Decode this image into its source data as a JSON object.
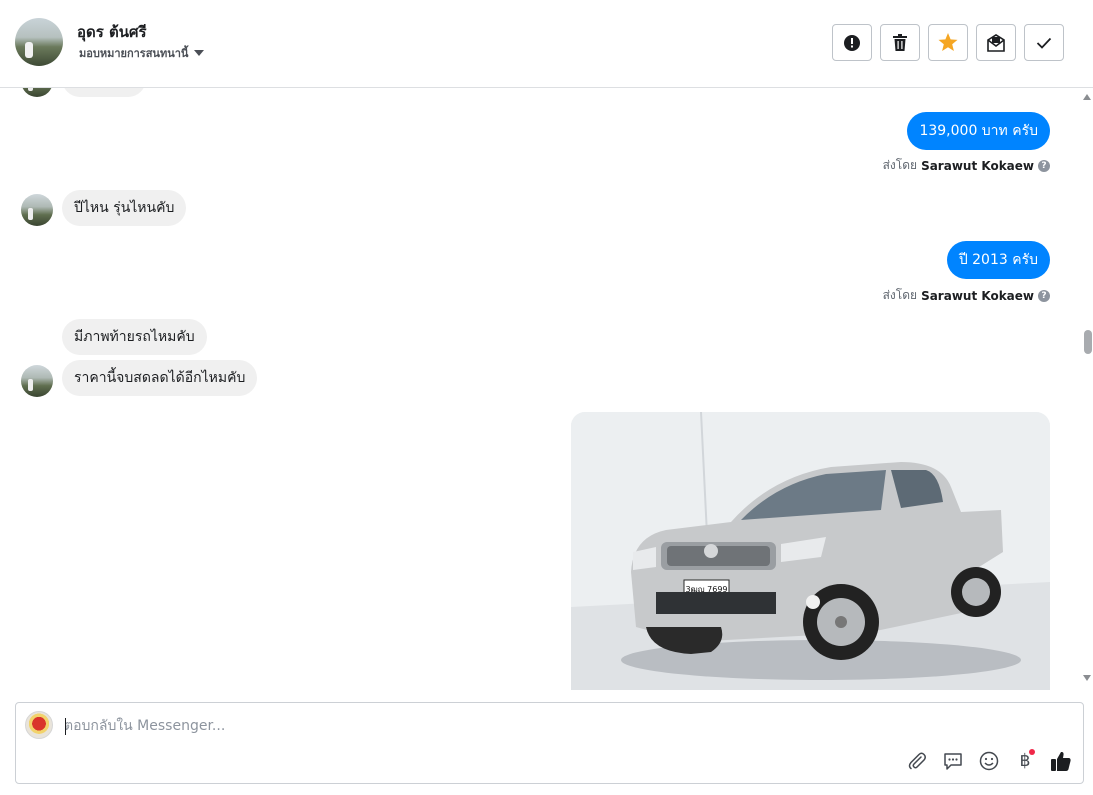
{
  "header": {
    "contact_name": "อุดร ต้นศรี",
    "assign_label": "มอบหมายการสนทนานี้"
  },
  "toolbar": {
    "icons": [
      "alert-icon",
      "trash-icon",
      "star-icon",
      "mark-unread-icon",
      "check-icon"
    ],
    "star_color": "#f5a623"
  },
  "messages": [
    {
      "from": "them",
      "text": "ปีไหน รุ่นไหนคับ"
    },
    {
      "from": "me",
      "text": "139,000 บาท ครับ"
    },
    {
      "from": "me",
      "text": "ปี 2013 ครับ"
    },
    {
      "from": "them",
      "text": "มีภาพท้ายรถไหมคับ"
    },
    {
      "from": "them",
      "text": "ราคานี้จบสดลดได้อีกไหมคับ"
    }
  ],
  "sent_by": {
    "prefix": "ส่งโดย",
    "name": "Sarawut Kokaew"
  },
  "photo": {
    "plate_text": "3ฒญ 7699"
  },
  "composer": {
    "placeholder": "ตอบกลับใน Messenger..."
  },
  "composer_tools": [
    "paperclip-icon",
    "saved-replies-icon",
    "emoji-icon",
    "baht-payment-icon",
    "thumbs-up-icon"
  ],
  "colors": {
    "outgoing_bubble": "#0084ff",
    "incoming_bubble": "#f0f0f0",
    "like_icon": "#1c1e21"
  }
}
